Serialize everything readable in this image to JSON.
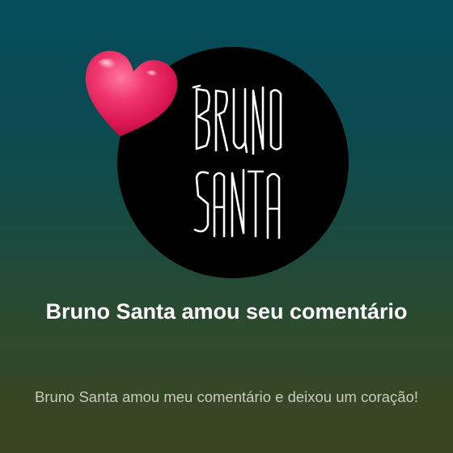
{
  "notification": {
    "title": "Bruno Santa amou seu comentário",
    "message": "Bruno Santa amou meu comentário e deixou um coração!"
  },
  "avatar": {
    "logo_text_line1": "BRUNO",
    "logo_text_line2": "SANTA",
    "background_color": "#000000",
    "logo_color": "#ffffff"
  },
  "reaction": {
    "icon": "heart-icon",
    "color": "#e8245c"
  }
}
